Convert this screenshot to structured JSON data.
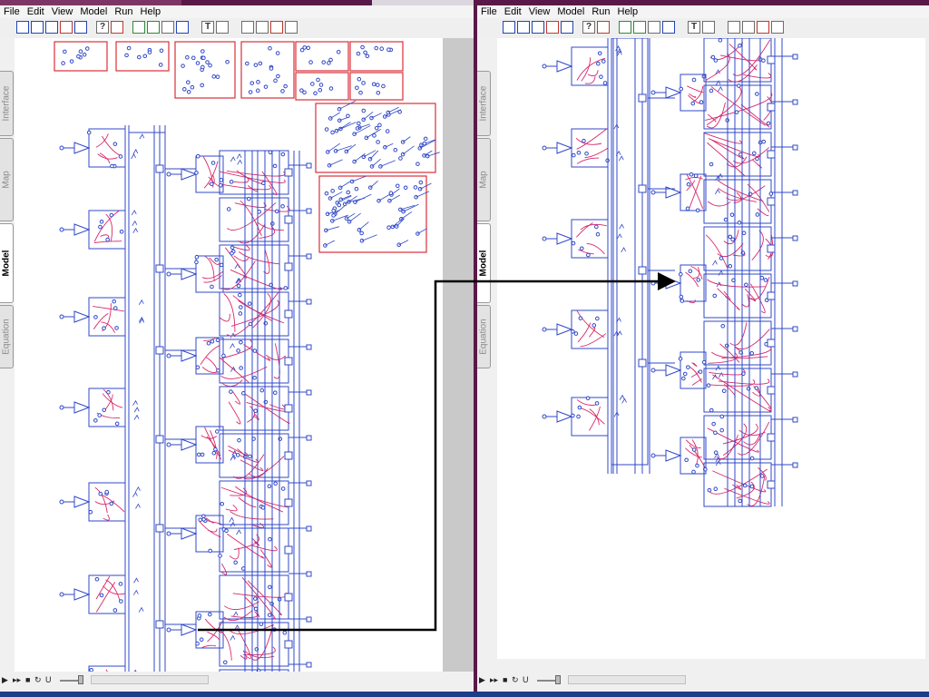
{
  "menus": [
    "File",
    "Edit",
    "View",
    "Model",
    "Run",
    "Help"
  ],
  "toolbar_icons": [
    "rectangle-tool-icon",
    "flow-tool-icon",
    "circle-tool-icon",
    "arrow-tool-icon",
    "rounded-rect-tool-icon",
    "help-icon",
    "stop-icon",
    "graph-icon",
    "table-icon",
    "knob-icon",
    "numeric-display-icon",
    "text-tool-icon",
    "picture-icon",
    "pointer-tool-icon",
    "brush-tool-icon",
    "dynamite-tool-icon",
    "ghost-tool-icon"
  ],
  "toolbar_glyphs": {
    "text_tool": "T",
    "help": "?"
  },
  "side_tabs": [
    "Interface",
    "Map",
    "Model",
    "Equation"
  ],
  "active_tab": "Model",
  "status_controls": {
    "u_label": "U"
  },
  "colors": {
    "stock_blue": "#3048c8",
    "connector_red": "#d8286a",
    "sector_frame": "#d8303a",
    "arrow": "#000000",
    "title_strip": "#5a1848"
  }
}
